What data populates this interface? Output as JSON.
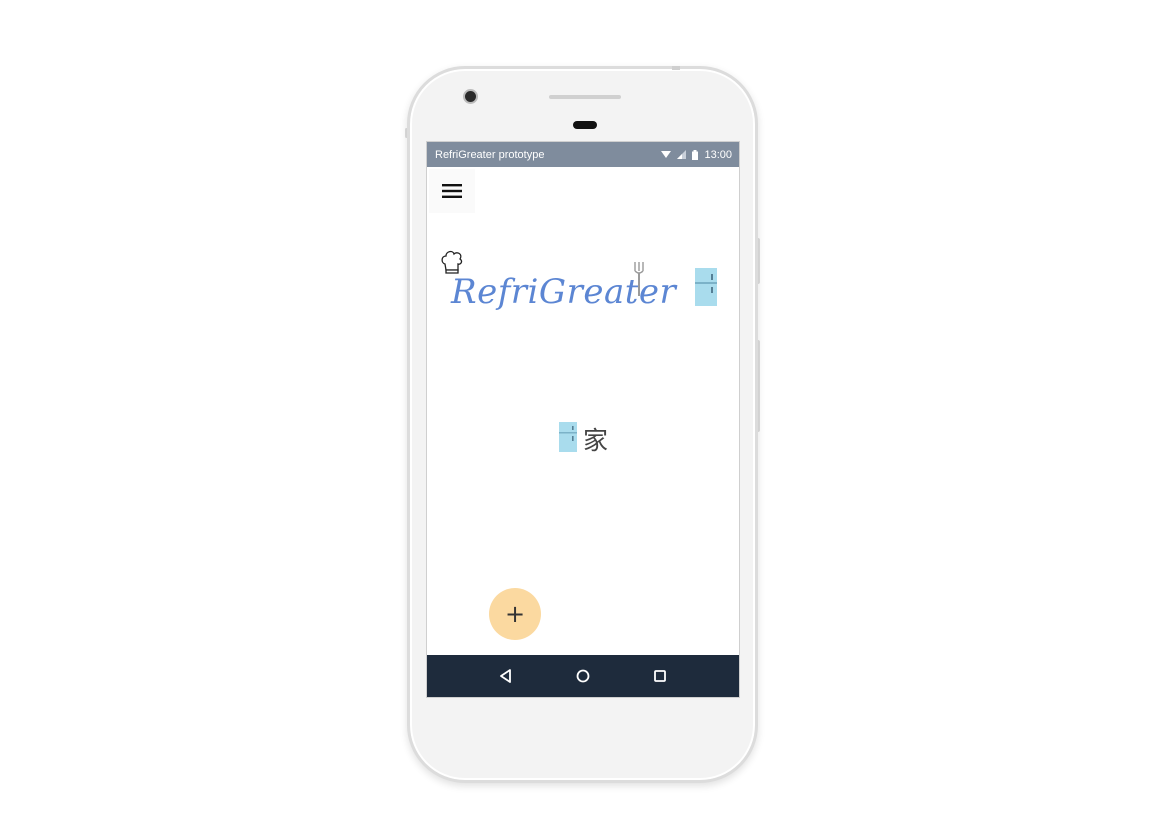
{
  "status_bar": {
    "app_title": "RefriGreater prototype",
    "time": "13:00",
    "icons": [
      "wifi-icon",
      "signal-icon",
      "battery-icon"
    ]
  },
  "header": {
    "menu_icon": "hamburger-menu-icon"
  },
  "logo": {
    "text": "RefriGreater",
    "icons": [
      "chef-hat-icon",
      "fork-icon",
      "fridge-icon"
    ]
  },
  "home": {
    "icon": "fridge-icon",
    "label": "家"
  },
  "fab": {
    "label": "+"
  },
  "nav_bar": {
    "items": [
      "back-icon",
      "home-icon",
      "recents-icon"
    ]
  },
  "colors": {
    "status_bar": "#7f8c9d",
    "nav_bar": "#1e2b3c",
    "logo_text": "#5c86d3",
    "fab": "#fbd9a0",
    "fridge": "#a9dced"
  }
}
